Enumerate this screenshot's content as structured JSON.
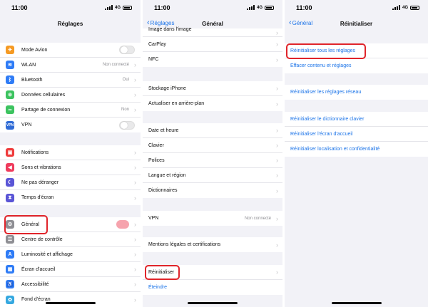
{
  "colors": {
    "accent": "#1a73e8",
    "highlight": "#e0242a",
    "background": "#f2f2f7"
  },
  "status": {
    "time": "11:00",
    "network": "4G"
  },
  "screen1": {
    "title": "Réglages",
    "group1": [
      {
        "label": "Mode Avion",
        "icon": "airplane-icon",
        "color": "#f59a23",
        "control": "toggle"
      },
      {
        "label": "WLAN",
        "icon": "wifi-icon",
        "color": "#2f7cf6",
        "value": "Non connecté"
      },
      {
        "label": "Bluetooth",
        "icon": "bluetooth-icon",
        "color": "#2f7cf6",
        "value": "Oui"
      },
      {
        "label": "Données cellulaires",
        "icon": "antenna-icon",
        "color": "#3cc35f"
      },
      {
        "label": "Partage de connexion",
        "icon": "hotspot-icon",
        "color": "#3cc35f",
        "value": "Non"
      },
      {
        "label": "VPN",
        "icon": "vpn-icon",
        "color": "#2f6bd6",
        "control": "toggle"
      }
    ],
    "group2": [
      {
        "label": "Notifications",
        "icon": "bell-icon",
        "color": "#ef3b3b"
      },
      {
        "label": "Sons et vibrations",
        "icon": "speaker-icon",
        "color": "#ef3b5c"
      },
      {
        "label": "Ne pas déranger",
        "icon": "moon-icon",
        "color": "#5a55d6"
      },
      {
        "label": "Temps d'écran",
        "icon": "hourglass-icon",
        "color": "#5a55d6"
      }
    ],
    "group3": [
      {
        "label": "Général",
        "icon": "gear-icon",
        "color": "#8e8e93",
        "badge": true
      },
      {
        "label": "Centre de contrôle",
        "icon": "switches-icon",
        "color": "#8e8e93"
      },
      {
        "label": "Luminosité et affichage",
        "icon": "brightness-icon",
        "color": "#2f7cf6"
      },
      {
        "label": "Écran d'accueil",
        "icon": "grid-icon",
        "color": "#2f7cf6"
      },
      {
        "label": "Accessibilité",
        "icon": "accessibility-icon",
        "color": "#2f7cf6"
      },
      {
        "label": "Fond d'écran",
        "icon": "flower-icon",
        "color": "#35a8e0"
      }
    ]
  },
  "screen2": {
    "title": "Général",
    "back": "Réglages",
    "partial": "Image dans l'image",
    "group1": [
      "CarPlay",
      "NFC"
    ],
    "group2": [
      "Stockage iPhone",
      "Actualiser en arrière-plan"
    ],
    "group3": [
      "Date et heure",
      "Clavier",
      "Polices",
      "Langue et région",
      "Dictionnaires"
    ],
    "vpn": {
      "label": "VPN",
      "value": "Non connecté"
    },
    "legal": "Mentions légales et certifications",
    "reset": "Réinitialiser",
    "shutdown": "Éteindre"
  },
  "screen3": {
    "title": "Réinitialiser",
    "back": "Général",
    "group1": [
      "Réinitialiser tous les réglages",
      "Effacer contenu et réglages"
    ],
    "group2": [
      "Réinitialiser les réglages réseau"
    ],
    "group3": [
      "Réinitialiser le dictionnaire clavier",
      "Réinitialiser l'écran d'accueil",
      "Réinitialiser localisation et confidentialité"
    ]
  }
}
